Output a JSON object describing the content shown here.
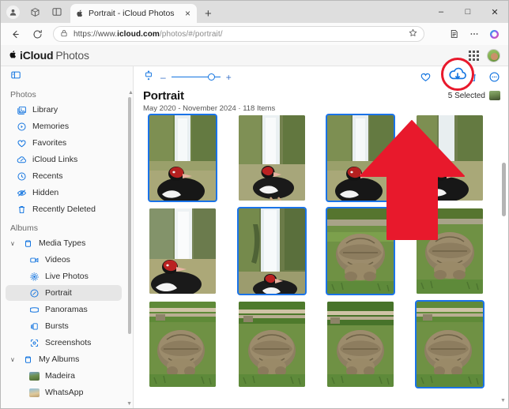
{
  "browser": {
    "profile_icon": "profile-avatar-icon",
    "workspaces_icon": "workspaces-icon",
    "tab_search_icon": "tab-search-icon",
    "tab": {
      "favicon": "apple-favicon",
      "title": "Portrait - iCloud Photos",
      "close_label": "×"
    },
    "new_tab_label": "+",
    "window_controls": {
      "minimize": "–",
      "maximize": "□",
      "close": "✕"
    },
    "nav": {
      "back_icon": "back-arrow-icon",
      "reload_icon": "reload-icon",
      "lock_icon": "site-info-icon",
      "url_scheme": "https://www.",
      "url_domain": "icloud.com",
      "url_path": "/photos/#/portrait/",
      "favorite_icon": "star-icon",
      "collections_icon": "collections-icon",
      "settings_icon": "ellipsis-icon",
      "copilot_icon": "copilot-icon"
    }
  },
  "icloud_header": {
    "apple_logo": "",
    "brand_bold": "iCloud",
    "brand_light": "Photos",
    "apps_grid_icon": "app-grid-icon",
    "account_avatar": "account-avatar"
  },
  "sidebar": {
    "toggle_icon": "sidebar-toggle-icon",
    "sections": [
      {
        "label": "Photos",
        "items": [
          {
            "label": "Library",
            "icon": "photo-library-icon"
          },
          {
            "label": "Memories",
            "icon": "memories-icon"
          },
          {
            "label": "Favorites",
            "icon": "heart-icon"
          },
          {
            "label": "iCloud Links",
            "icon": "cloud-link-icon"
          },
          {
            "label": "Recents",
            "icon": "clock-icon"
          },
          {
            "label": "Hidden",
            "icon": "eye-slash-icon"
          },
          {
            "label": "Recently Deleted",
            "icon": "trash-icon"
          }
        ]
      },
      {
        "label": "Albums",
        "items": [
          {
            "label": "Media Types",
            "icon": "folder-icon",
            "group": true,
            "expanded": true,
            "chevron": "∨"
          },
          {
            "label": "Videos",
            "icon": "video-icon",
            "sub": true
          },
          {
            "label": "Live Photos",
            "icon": "live-photo-icon",
            "sub": true
          },
          {
            "label": "Portrait",
            "icon": "portrait-icon",
            "sub": true,
            "active": true
          },
          {
            "label": "Panoramas",
            "icon": "panorama-icon",
            "sub": true
          },
          {
            "label": "Bursts",
            "icon": "bursts-icon",
            "sub": true
          },
          {
            "label": "Screenshots",
            "icon": "screenshot-icon",
            "sub": true
          },
          {
            "label": "My Albums",
            "icon": "folder-icon",
            "group": true,
            "expanded": true,
            "chevron": "∨"
          },
          {
            "label": "Madeira",
            "icon": "album-thumb-madeira",
            "sub": true
          },
          {
            "label": "WhatsApp",
            "icon": "album-thumb-whatsapp",
            "sub": true
          }
        ]
      }
    ]
  },
  "main": {
    "toolbar": {
      "view_options_icon": "view-options-icon",
      "zoom_out_label": "–",
      "zoom_in_label": "+",
      "zoom_slider_value": 78,
      "actions": [
        {
          "name": "favorite-icon",
          "glyph": "heart"
        },
        {
          "name": "download-icon",
          "glyph": "cloud-download",
          "highlighted": true
        },
        {
          "name": "delete-icon",
          "glyph": "trash"
        },
        {
          "name": "more-options-icon",
          "glyph": "ellipsis-circle"
        }
      ]
    },
    "album_title": "Portrait",
    "album_subtitle": "May 2020 - November 2024  ·  118 Items",
    "selection_count": "5 Selected",
    "photos": [
      {
        "subject": "duck-waterfall",
        "selected": true
      },
      {
        "subject": "duck-waterfall",
        "selected": false
      },
      {
        "subject": "duck-waterfall",
        "selected": true
      },
      {
        "subject": "duck-waterfall",
        "selected": false
      },
      {
        "subject": "duck-waterfall",
        "selected": false
      },
      {
        "subject": "duck-waterfall",
        "selected": true
      },
      {
        "subject": "tortoise-grass",
        "selected": true
      },
      {
        "subject": "tortoise-grass",
        "selected": false
      },
      {
        "subject": "tortoise-grass",
        "selected": false
      },
      {
        "subject": "tortoise-grass",
        "selected": false
      },
      {
        "subject": "tortoise-grass",
        "selected": false
      },
      {
        "subject": "tortoise-grass",
        "selected": true
      }
    ]
  },
  "annotation": {
    "arrow_color": "#E8192C",
    "highlight_color": "#E8192C",
    "target_icon": "download-icon"
  },
  "colors": {
    "accent_blue": "#1274e0",
    "selection_blue": "#1a73e8",
    "chrome_gray": "#dedede"
  }
}
